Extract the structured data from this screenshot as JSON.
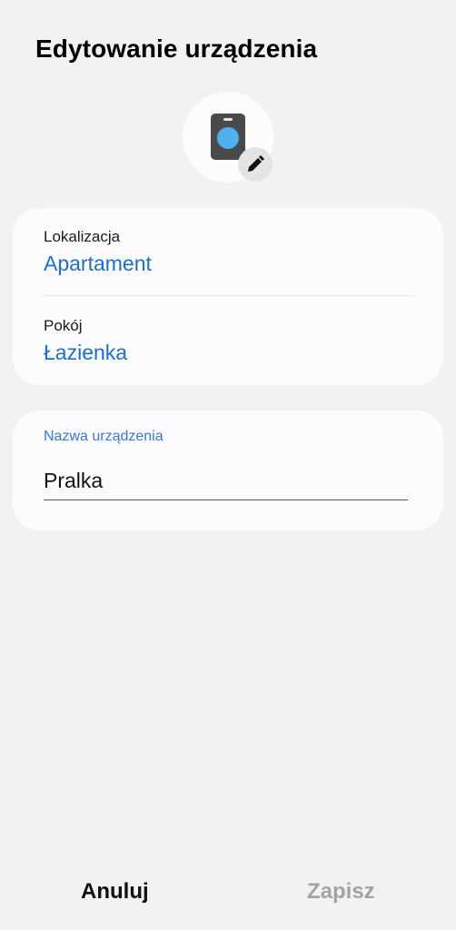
{
  "header": {
    "title": "Edytowanie urządzenia"
  },
  "device_icon": {
    "icon": "washing-machine-icon",
    "edit_icon": "pencil-icon"
  },
  "location_card": {
    "location_label": "Lokalizacja",
    "location_value": "Apartament",
    "room_label": "Pokój",
    "room_value": "Łazienka"
  },
  "name_card": {
    "label": "Nazwa urządzenia",
    "value": "Pralka"
  },
  "footer": {
    "cancel_label": "Anuluj",
    "save_label": "Zapisz"
  },
  "colors": {
    "accent": "#1d6fc5",
    "background": "#f2f1f3",
    "card": "#fcfbfd",
    "disabled": "#a3a2a5"
  }
}
